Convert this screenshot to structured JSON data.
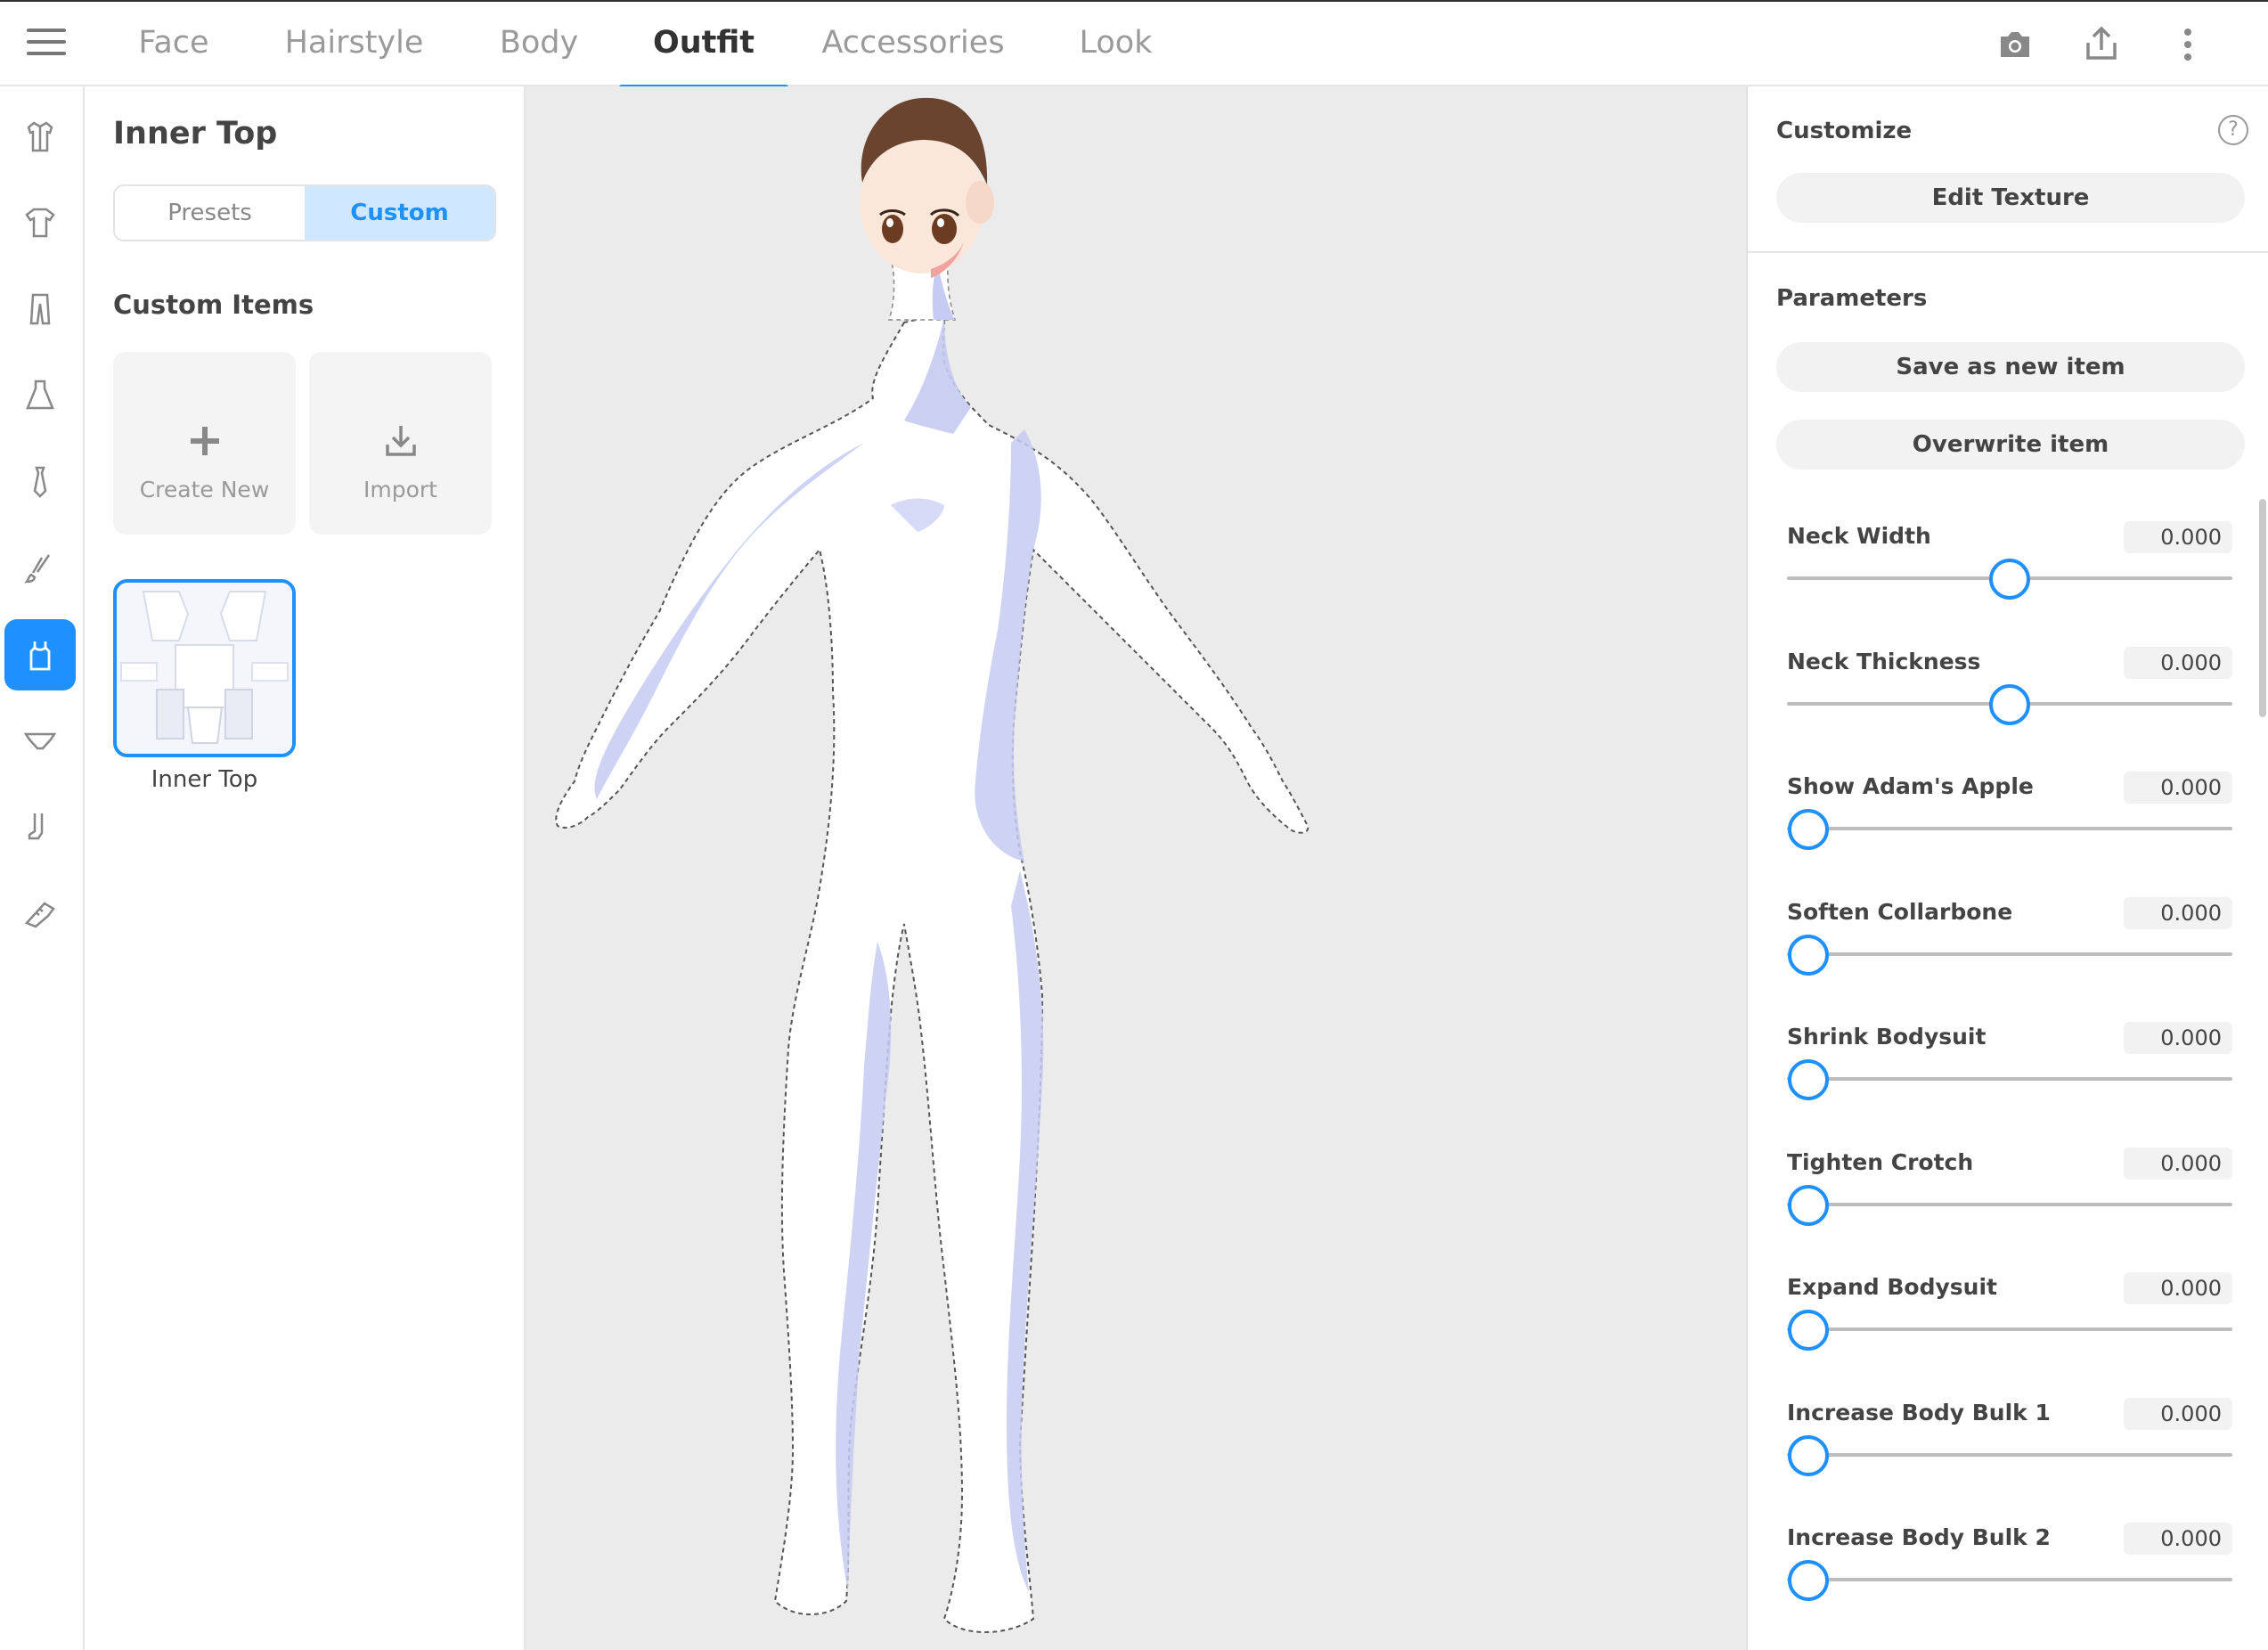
{
  "tabs": [
    {
      "label": "Face",
      "active": false
    },
    {
      "label": "Hairstyle",
      "active": false
    },
    {
      "label": "Body",
      "active": false
    },
    {
      "label": "Outfit",
      "active": true
    },
    {
      "label": "Accessories",
      "active": false
    },
    {
      "label": "Look",
      "active": false
    }
  ],
  "top_icons": [
    "camera-icon",
    "share-icon",
    "more-vert-icon"
  ],
  "rail": {
    "items": [
      {
        "icon": "coat-icon"
      },
      {
        "icon": "shirt-icon"
      },
      {
        "icon": "pants-icon"
      },
      {
        "icon": "dress-icon"
      },
      {
        "icon": "tie-icon"
      },
      {
        "icon": "brush-icon"
      },
      {
        "icon": "inner-top-icon",
        "active": true
      },
      {
        "icon": "underwear-icon"
      },
      {
        "icon": "sock-icon"
      },
      {
        "icon": "shoe-icon"
      }
    ]
  },
  "panel": {
    "title": "Inner Top",
    "segments": [
      "Presets",
      "Custom"
    ],
    "active_segment": "Custom",
    "custom_items_title": "Custom Items",
    "create_new_label": "Create New",
    "import_label": "Import",
    "item_label": "Inner Top"
  },
  "right": {
    "customize_title": "Customize",
    "edit_texture_label": "Edit Texture",
    "parameters_title": "Parameters",
    "save_new_label": "Save as new item",
    "overwrite_label": "Overwrite item",
    "params": [
      {
        "name": "Neck Width",
        "value": "0.000",
        "position": 0.5
      },
      {
        "name": "Neck Thickness",
        "value": "0.000",
        "position": 0.5
      },
      {
        "name": "Show Adam's Apple",
        "value": "0.000",
        "position": 0.0
      },
      {
        "name": "Soften Collarbone",
        "value": "0.000",
        "position": 0.0
      },
      {
        "name": "Shrink Bodysuit",
        "value": "0.000",
        "position": 0.0
      },
      {
        "name": "Tighten Crotch",
        "value": "0.000",
        "position": 0.0
      },
      {
        "name": "Expand Bodysuit",
        "value": "0.000",
        "position": 0.0
      },
      {
        "name": "Increase Body Bulk 1",
        "value": "0.000",
        "position": 0.0
      },
      {
        "name": "Increase Body Bulk 2",
        "value": "0.000",
        "position": 0.0
      }
    ]
  },
  "colors": {
    "accent": "#1e90ff",
    "segment_active_bg": "#cfe7ff",
    "viewport_bg": "#ebebeb",
    "bodysuit": "#ffffff",
    "bodysuit_shadow": "#c5cbf2",
    "hair": "#6b4430"
  }
}
